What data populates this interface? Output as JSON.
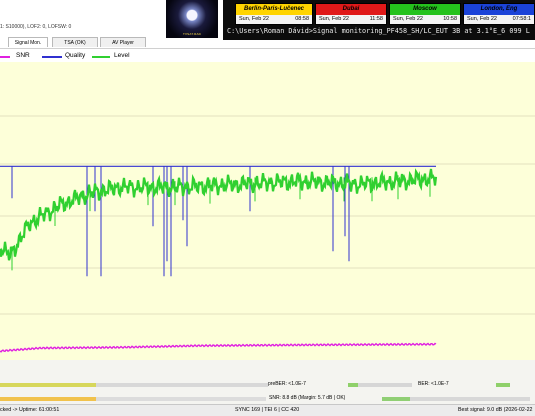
{
  "app": {
    "info_text": "1: S10000), LOF2: 0, LOFSW: 0",
    "logo_text": "TVSAT.RAD",
    "tabs": [
      {
        "label": "Signal Mon."
      },
      {
        "label": "TSA (OK)"
      },
      {
        "label": "AV Player"
      }
    ]
  },
  "world_clock": {
    "clocks": [
      {
        "city": "Berlin-Paris-Lučenec",
        "day": "Sun, Feb 22",
        "time": "08:58",
        "color": "#ffd400"
      },
      {
        "city": "Dubai",
        "day": "Sun, Feb 22",
        "time": "11:58",
        "color": "#e01919"
      },
      {
        "city": "Moscow",
        "day": "Sun, Feb 22",
        "time": "10:58",
        "color": "#25c21d"
      },
      {
        "city": "London, Eng",
        "day": "Sun, Feb 22",
        "time": "07:58:1",
        "color": "#1b43d8"
      }
    ],
    "command_line": "C:\\Users\\Roman Dávid>Signal monitoring_PF458_SH/LC_EUT 3B at 3.1°E_6 099 L"
  },
  "legend": {
    "items": [
      {
        "label": "SNR",
        "color": "#e020e0"
      },
      {
        "label": "Quality",
        "color": "#3030d0"
      },
      {
        "label": "Level",
        "color": "#30d030"
      }
    ]
  },
  "status": {
    "prober": "preBER: <1.0E-7",
    "ber": "BER: <1.0E-7",
    "snr_text": "SNR: 8.8 dB (Margin: 5.7 dB | OK)"
  },
  "footer": {
    "left": "cked -> Uptime: 61:00:51",
    "center": "SYNC 169 | TEI 6 | CC 420",
    "right": "Best signal: 9.0 dB (2026-02-22"
  },
  "chart_data": {
    "type": "line",
    "series": [
      {
        "name": "SNR",
        "color": "#e020e0",
        "points": [
          [
            0,
            0.2
          ],
          [
            40,
            0.4
          ],
          [
            120,
            0.45
          ],
          [
            200,
            0.56
          ],
          [
            300,
            0.61
          ],
          [
            436,
            0.66
          ]
        ]
      },
      {
        "name": "Quality",
        "color": "#3030d0",
        "baseline": 0.65,
        "dropouts": [
          12,
          87,
          95,
          101,
          153,
          164,
          167,
          171,
          183,
          187,
          250,
          333,
          345,
          349
        ]
      },
      {
        "name": "Level",
        "color": "#30d030",
        "points": [
          [
            0,
            0.38
          ],
          [
            10,
            0.35
          ],
          [
            30,
            0.46
          ],
          [
            60,
            0.52
          ],
          [
            90,
            0.56
          ],
          [
            120,
            0.58
          ],
          [
            180,
            0.58
          ],
          [
            240,
            0.59
          ],
          [
            300,
            0.6
          ],
          [
            360,
            0.59
          ],
          [
            436,
            0.61
          ]
        ]
      }
    ]
  }
}
